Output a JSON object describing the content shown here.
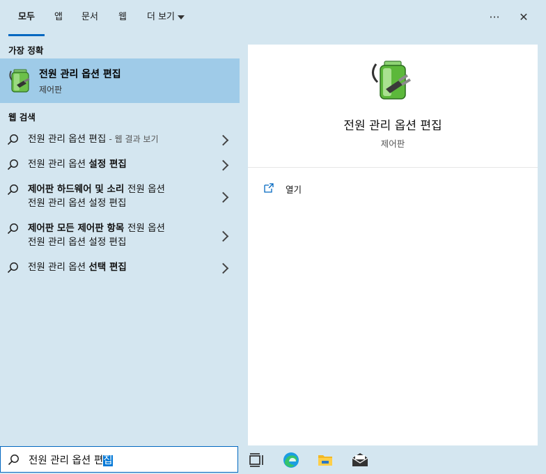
{
  "tabs": [
    {
      "label": "모두"
    },
    {
      "label": "앱"
    },
    {
      "label": "문서"
    },
    {
      "label": "웹"
    },
    {
      "label": "더 보기"
    }
  ],
  "header": {
    "more_options": "···",
    "close": "✕"
  },
  "best_match": {
    "heading": "가장 정확",
    "title": "전원 관리 옵션 편집",
    "subtitle": "제어판"
  },
  "web_search": {
    "heading": "웹 검색",
    "items": [
      {
        "bold": "전원 관리 옵션 편집",
        "rest": "",
        "suffix": "- 웹 결과 보기"
      },
      {
        "bold": "전원 관리 옵션 ",
        "rest": "설정 편집",
        "suffix": ""
      },
      {
        "line1_bold": "제어판 하드웨어 및 소리 ",
        "line1_rest": "전원 옵션",
        "line2_rest": "전원 관리 옵션 설정 편집"
      },
      {
        "line1_bold": "제어판 모든 제어판 항목 ",
        "line1_rest": "전원 옵션",
        "line2_rest": "전원 관리 옵션 설정 편집"
      },
      {
        "bold": "전원 관리 옵션 ",
        "rest": "선택 편집",
        "suffix": ""
      }
    ]
  },
  "detail": {
    "title": "전원 관리 옵션 편집",
    "subtitle": "제어판",
    "actions": [
      {
        "label": "열기"
      }
    ]
  },
  "search": {
    "query_before": "전원 관리 옵션 편",
    "query_selected": "집"
  },
  "taskbar": [
    "task-view-icon",
    "edge-icon",
    "file-explorer-icon",
    "mail-icon"
  ]
}
